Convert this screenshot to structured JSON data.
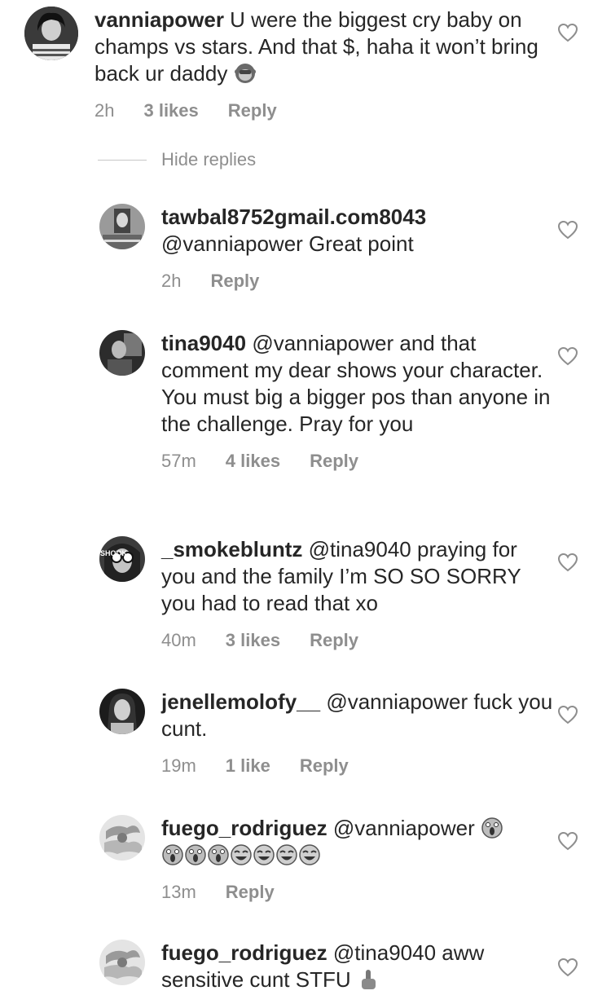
{
  "comments": [
    {
      "id": "c1",
      "username": "vanniapower",
      "text": "U were the biggest cry baby on champs vs stars. And that $, haha it won’t bring back ur daddy",
      "emojis": [
        "monkey-face"
      ],
      "time": "2h",
      "likes": "3 likes",
      "reply": "Reply"
    },
    {
      "id": "c2",
      "username": "tawbal8752gmail.com8043",
      "text": "@vanniapower Great point",
      "time": "2h",
      "reply": "Reply"
    },
    {
      "id": "c3",
      "username": "tina9040",
      "text": "@vanniapower and that comment my dear shows your character.  You must big a bigger pos than anyone in the challenge.  Pray for you",
      "time": "57m",
      "likes": "4 likes",
      "reply": "Reply"
    },
    {
      "id": "c4",
      "username": "_smokebluntz",
      "text": "@tina9040 praying for you and the family I’m SO SO SORRY you had to read that xo",
      "time": "40m",
      "likes": "3 likes",
      "reply": "Reply"
    },
    {
      "id": "c5",
      "username": "jenellemolofy__",
      "text": "@vanniapower fuck you cunt.",
      "time": "19m",
      "likes": "1 like",
      "reply": "Reply"
    },
    {
      "id": "c6",
      "username": "fuego_rodriguez",
      "text": "@vanniapower",
      "emojis": [
        "screaming-face",
        "screaming-face",
        "screaming-face",
        "screaming-face",
        "joy-face",
        "joy-face",
        "joy-face",
        "joy-face"
      ],
      "time": "13m",
      "reply": "Reply"
    },
    {
      "id": "c7",
      "username": "fuego_rodriguez",
      "text": "@tina9040 aww sensitive cunt STFU",
      "emojis": [
        "middle-finger"
      ]
    }
  ],
  "hide_replies": "Hide replies",
  "avatar_text_smoke": "SHOOK",
  "colors": {
    "text": "#262626",
    "meta": "#8e8e8e",
    "divider": "#c7c7c7"
  }
}
